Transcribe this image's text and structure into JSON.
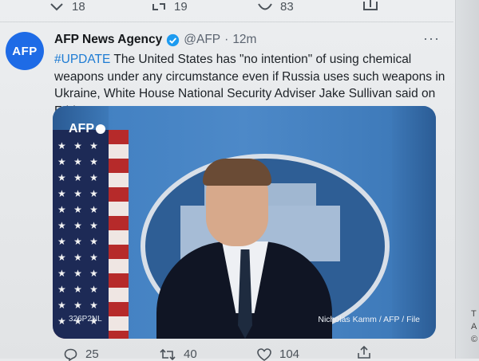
{
  "prev_actions": {
    "replies": "18",
    "retweets": "19",
    "likes": "83"
  },
  "tweet": {
    "avatar_text": "AFP",
    "name": "AFP News Agency",
    "handle": "@AFP",
    "separator": "·",
    "time": "12m",
    "hashtag": "#UPDATE",
    "text": " The United States has \"no intention\" of using chemical weapons under any circumstance even if Russia uses such weapons in Ukraine, White House National Security Adviser Jake Sullivan said on Friday",
    "media": {
      "logo": "AFP",
      "code": "326P2NL",
      "credit": "Nicholas Kamm / AFP / File"
    },
    "actions": {
      "replies": "25",
      "retweets": "40",
      "likes": "104"
    }
  },
  "side_letters": [
    "T",
    "A",
    "©"
  ],
  "colors": {
    "accent": "#1d7bd3",
    "avatar": "#1e6be6"
  }
}
